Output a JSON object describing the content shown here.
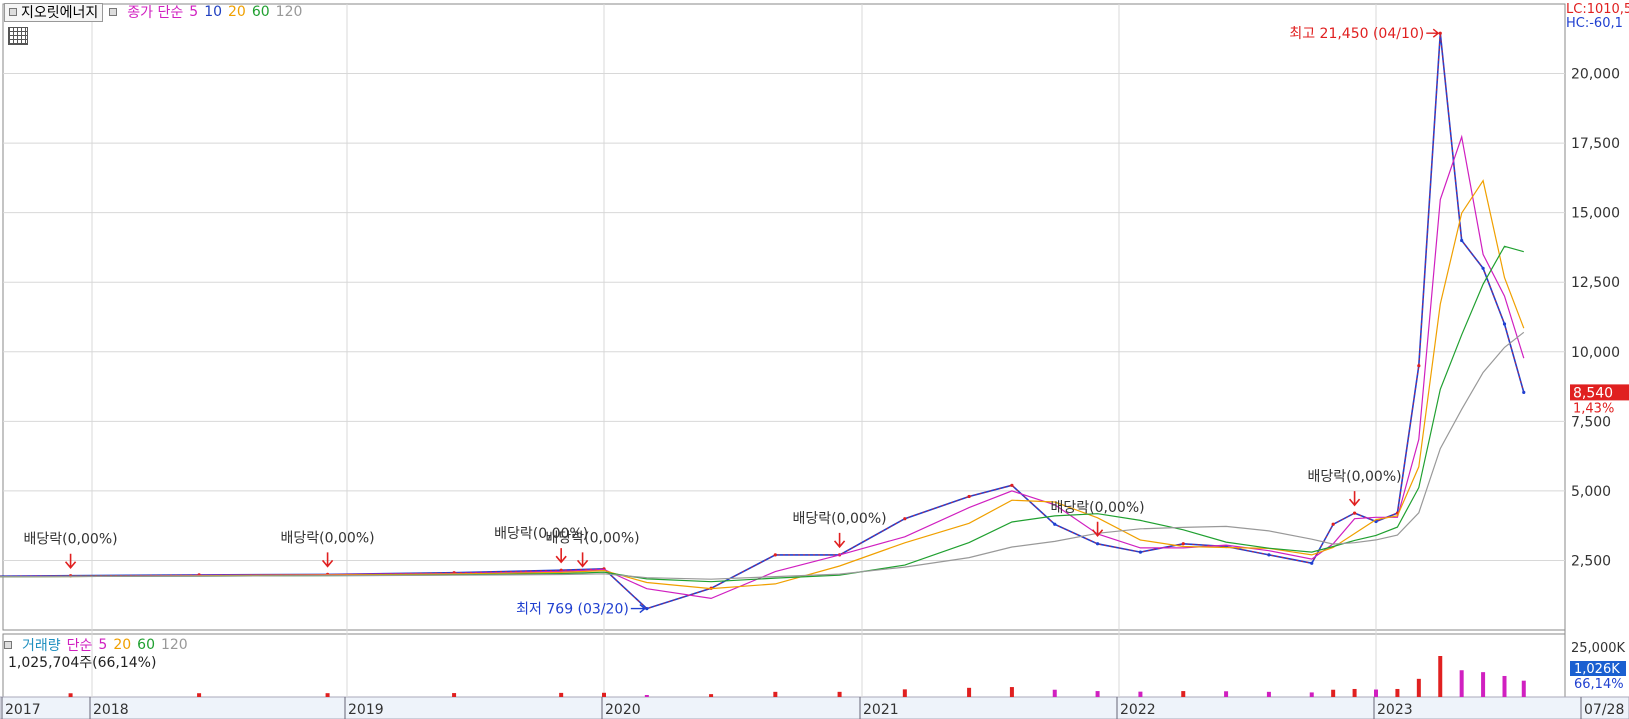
{
  "header": {
    "stock_name": "지오릿에너지",
    "price_legend": {
      "label": "종가 단순",
      "periods": [
        "5",
        "10",
        "20",
        "60",
        "120"
      ]
    },
    "lc_label": "LC:1010,5",
    "hc_label": "HC:-60,1"
  },
  "volume_header": {
    "label": "거래량",
    "ma_label": "단순",
    "periods": [
      "5",
      "20",
      "60",
      "120"
    ],
    "value_text": "1,025,704주(66,14%)"
  },
  "colors": {
    "ma5": "#d020c0",
    "ma10": "#2040c0",
    "ma20": "#f0a000",
    "ma60": "#20a030",
    "ma120": "#999999",
    "up": "#e02020",
    "down": "#2040d0",
    "volume_label": "#2090c0",
    "grid": "#d8d8d8"
  },
  "chart_data": [
    {
      "type": "line",
      "description_note": "",
      "x": [
        "2017-01",
        "2017-06",
        "2017-12",
        "2018-06",
        "2018-12",
        "2019-06",
        "2019-11",
        "2020-01",
        "2020-03",
        "2020-06",
        "2020-09",
        "2020-12",
        "2021-03",
        "2021-06",
        "2021-08",
        "2021-10",
        "2021-12",
        "2022-02",
        "2022-04",
        "2022-06",
        "2022-08",
        "2022-10",
        "2022-11",
        "2022-12",
        "2023-01",
        "2023-02",
        "2023-03",
        "2023-04",
        "2023-05",
        "2023-06",
        "2023-07",
        "2023-07-28"
      ],
      "series": [
        {
          "name": "종가",
          "values": [
            1900,
            1920,
            1950,
            1980,
            2000,
            2060,
            2150,
            2200,
            769,
            1500,
            2700,
            2700,
            4000,
            4800,
            5200,
            3800,
            3100,
            2800,
            3100,
            3000,
            2700,
            2400,
            3800,
            4200,
            3900,
            4200,
            9500,
            21450,
            14000,
            13000,
            11000,
            8540
          ]
        }
      ],
      "y_ticks": [
        2500,
        5000,
        7500,
        10000,
        12500,
        15000,
        17500,
        20000
      ],
      "y_tick_labels": [
        "2,500",
        "5,000",
        "7,500",
        "10,000",
        "12,500",
        "15,000",
        "17,500",
        "20,000"
      ],
      "ylim": [
        0,
        22500
      ],
      "x_tick_labels": [
        "2017",
        "2018",
        "2019",
        "2020",
        "2021",
        "2022",
        "2023",
        "07/28"
      ],
      "annotations": {
        "high_label": "최고 21,450 (04/10)",
        "low_label": "최저 769 (03/20)",
        "dividend_labels": [
          "배당락(0,00%)",
          "배당락(0,00%)",
          "배당락(0,00%)",
          "배당락(0,00%)",
          "배당락(0,00%)",
          "배당락(0,00%)",
          "배당락(0,00%)"
        ]
      },
      "current_price": "8,540",
      "current_change": "1,43%"
    },
    {
      "type": "bar",
      "name": "거래량",
      "value_label_primary": "1,026K",
      "value_label_secondary": "66,14%",
      "top_tick_label": "25,000K"
    }
  ]
}
